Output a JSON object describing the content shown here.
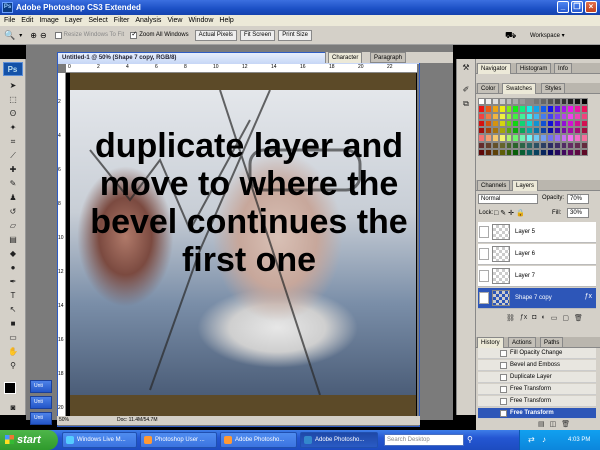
{
  "window": {
    "title": "Adobe Photoshop CS3 Extended",
    "app_icon": "Ps"
  },
  "menu": [
    "File",
    "Edit",
    "Image",
    "Layer",
    "Select",
    "Filter",
    "Analysis",
    "View",
    "Window",
    "Help"
  ],
  "options": {
    "resize_windows": "Resize Windows To Fit",
    "zoom_all": "Zoom All Windows",
    "actual_pixels": "Actual Pixels",
    "fit_screen": "Fit Screen",
    "print_size": "Print Size",
    "workspace": "Workspace ▾"
  },
  "tools_logo": "Ps",
  "document": {
    "title": "Untitled-1 @ 50% (Shape 7 copy, RGB/8)",
    "zoom": "50%",
    "doc_info": "Doc: 11.4M/54.7M"
  },
  "overlay_text": "duplicate layer and move to where the bevel continues the first one",
  "ruler": {
    "h": [
      "0",
      "2",
      "4",
      "6",
      "8",
      "10",
      "12",
      "14",
      "16",
      "18",
      "20",
      "22"
    ],
    "v": [
      "2",
      "4",
      "6",
      "8",
      "10",
      "12",
      "14",
      "16",
      "18",
      "20"
    ]
  },
  "minimized_docs": [
    "Unti",
    "Unti",
    "Unti"
  ],
  "char_tabs": [
    "Character",
    "Paragraph"
  ],
  "navigator_tabs": [
    "Navigator",
    "Histogram",
    "Info"
  ],
  "color_tabs": [
    "Color",
    "Swatches",
    "Styles"
  ],
  "layers_panel": {
    "tabs": [
      "Channels",
      "Layers"
    ],
    "blend_mode": "Normal",
    "opacity_label": "Opacity:",
    "opacity": "70%",
    "lock_label": "Lock:",
    "fill_label": "Fill:",
    "fill": "30%",
    "layers": [
      {
        "name": "Layer 5"
      },
      {
        "name": "Layer 6"
      },
      {
        "name": "Layer 7"
      },
      {
        "name": "Shape 7 copy",
        "selected": true
      }
    ]
  },
  "history_panel": {
    "tabs": [
      "History",
      "Actions",
      "Paths"
    ],
    "items": [
      {
        "name": "Fill Opacity Change"
      },
      {
        "name": "Bevel and Emboss"
      },
      {
        "name": "Duplicate Layer"
      },
      {
        "name": "Free Transform"
      },
      {
        "name": "Free Transform"
      },
      {
        "name": "Free Transform",
        "selected": true
      }
    ]
  },
  "taskbar": {
    "start": "start",
    "buttons": [
      "Windows Live M...",
      "Photoshop User ...",
      "Adobe Photosho...",
      "Adobe Photosho..."
    ],
    "search_placeholder": "Search Desktop",
    "clock": "4:03 PM"
  },
  "colors": {
    "titlebar": "#2456d2",
    "selection": "#2d56b8",
    "panel": "#d4d0c8",
    "canvas_band": "#5c4a28"
  }
}
